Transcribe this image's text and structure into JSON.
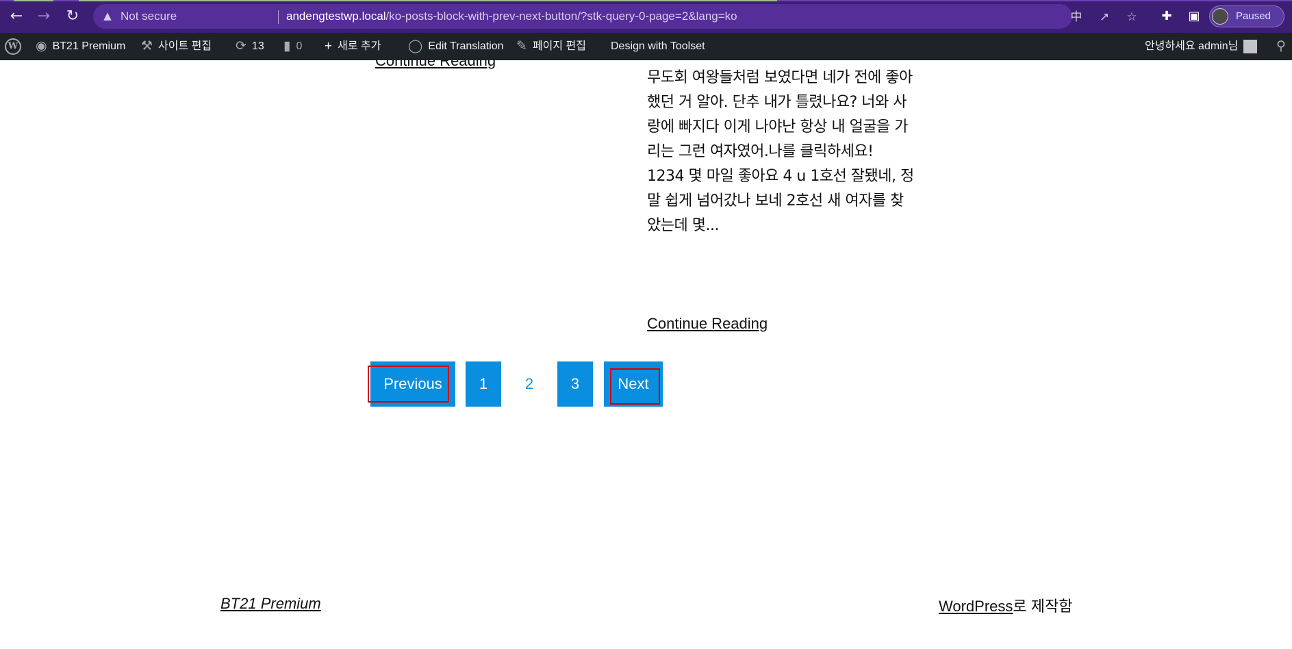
{
  "browser": {
    "security_label": "Not secure",
    "url_host": "andengtestwp.local",
    "url_rest": "/ko-posts-block-with-prev-next-button/?stk-query-0-page=2&lang=ko",
    "profile_status": "Paused",
    "theme_color": "#3c1f74"
  },
  "adminbar": {
    "site_name": "BT21 Premium",
    "edit_site": "사이트 편집",
    "updates_count": "13",
    "comments_count": "0",
    "new": "새로 추가",
    "edit_translation": "Edit Translation",
    "edit_page": "페이지 편집",
    "toolset": "Design with Toolset",
    "greeting": "안녕하세요 admin님"
  },
  "posts": {
    "left_continue": "Continue Reading",
    "excerpt": "했어 네가 날 더 좋아할 것 같아서 내가 다른 무도회 여왕들처럼 보였다면 네가 전에 좋아했던 거 알아. 단추 내가 틀렸나요? 너와 사랑에 빠지다 이게 나야난 항상 내 얼굴을 가리는 그런 여자였어.나를 클릭하세요! 1234 몇 마일 좋아요 4 u 1호선 잘됐네, 정말 쉽게 넘어갔나 보네 2호선 새 여자를 찾았는데 몇...",
    "right_continue": "Continue Reading"
  },
  "pagination": {
    "previous": "Previous",
    "pages": [
      "1",
      "2",
      "3"
    ],
    "current_page": "2",
    "next": "Next",
    "button_color": "#0a8ee0"
  },
  "footer": {
    "site_title": "BT21 Premium",
    "powered_link": "WordPress",
    "powered_suffix": "로 제작함"
  }
}
